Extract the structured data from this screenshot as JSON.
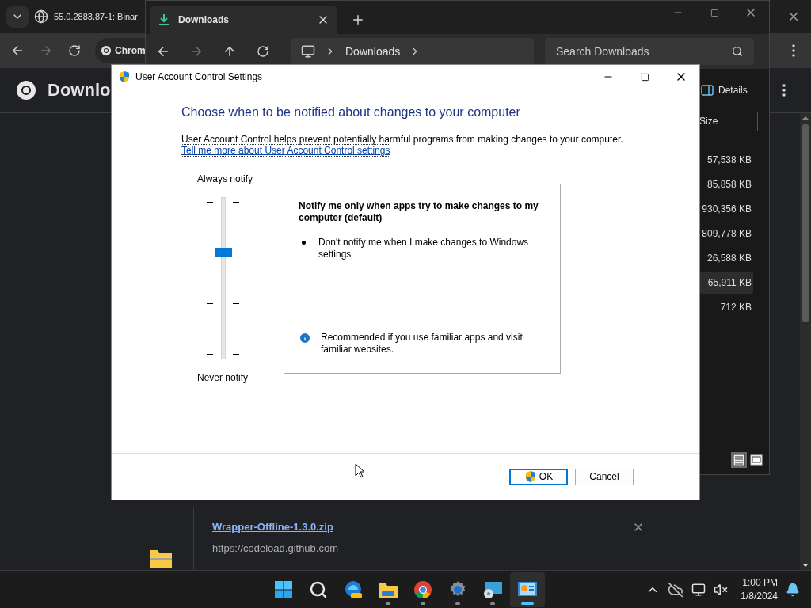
{
  "chrome": {
    "tab_title": "55.0.2883.87-1: Binar",
    "omnibox_chip": "Chrom",
    "page_title": "Downlo",
    "download": {
      "filename": "Wrapper-Offline-1.3.0.zip",
      "url": "https://codeload.github.com"
    }
  },
  "explorer": {
    "tab": {
      "title": "Downloads",
      "selected": true
    },
    "breadcrumb": [
      "Downloads"
    ],
    "search": {
      "placeholder": "Search Downloads"
    },
    "details_button": "Details",
    "size_column": "Size",
    "sizes": [
      {
        "text": "57,538 KB",
        "selected": false
      },
      {
        "text": "85,858 KB",
        "selected": false
      },
      {
        "text": "930,356 KB",
        "selected": false
      },
      {
        "text": "809,778 KB",
        "selected": false
      },
      {
        "text": "26,588 KB",
        "selected": false
      },
      {
        "text": "65,911 KB",
        "selected": true
      },
      {
        "text": "712 KB",
        "selected": false
      }
    ],
    "view_modes": [
      {
        "kind": "details",
        "selected": true
      },
      {
        "kind": "tiles",
        "selected": false
      }
    ]
  },
  "uac": {
    "title": "User Account Control Settings",
    "heading": "Choose when to be notified about changes to your computer",
    "description": "User Account Control helps prevent potentially harmful programs from making changes to your computer.",
    "link": "Tell me more about User Account Control settings",
    "slider": {
      "top_label": "Always notify",
      "bottom_label": "Never notify",
      "level": 0.67
    },
    "panel": {
      "title": "Notify me only when apps try to make changes to my computer (default)",
      "bullets": [
        "Don't notify me when I make changes to Windows settings"
      ],
      "note": "Recommended if you use familiar apps and visit familiar websites."
    },
    "buttons": [
      {
        "label": "OK",
        "kind": "elevated",
        "default": true
      },
      {
        "label": "Cancel",
        "kind": "plain",
        "default": false
      }
    ]
  },
  "taskbar": {
    "apps": [
      {
        "kind": "start",
        "running": false,
        "active": false
      },
      {
        "kind": "search",
        "running": false,
        "active": false
      },
      {
        "kind": "edge",
        "running": false,
        "active": false
      },
      {
        "kind": "files",
        "running": true,
        "active": false
      },
      {
        "kind": "chrome",
        "running": true,
        "active": false
      },
      {
        "kind": "settings",
        "running": true,
        "active": false
      },
      {
        "kind": "media",
        "running": true,
        "active": false
      },
      {
        "kind": "control-panel",
        "running": true,
        "active": true
      }
    ],
    "clock": {
      "time": "1:00 PM",
      "date": "1/8/2024"
    }
  }
}
